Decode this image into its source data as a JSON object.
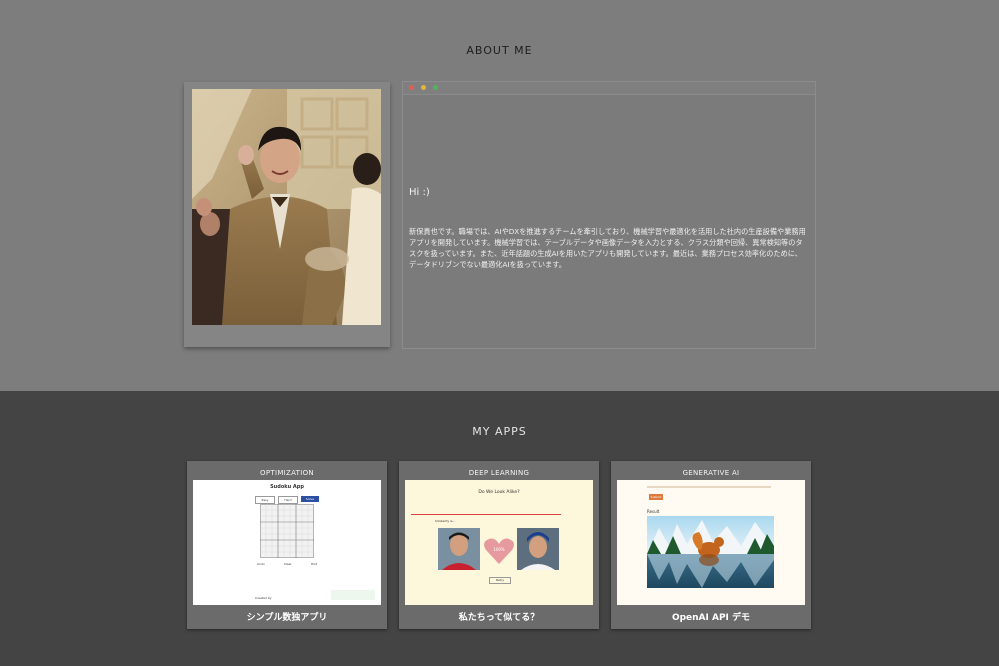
{
  "about": {
    "title": "ABOUT ME",
    "greeting": "Hi :)",
    "bio": "新保貴也です。職場では、AIやDXを推進するチームを牽引しており、機械学習や最適化を活用した社内の生産設備や業務用アプリを開発しています。機械学習では、テーブルデータや画像データを入力とする、クラス分類や回帰、異常検知等のタスクを扱っています。また、近年話題の生成AIを用いたアプリも開発しています。最近は、業務プロセス効率化のために、データドリブンでない最適化AIを扱っています。",
    "window_dots": [
      "#e0604f",
      "#e3b43a",
      "#4fb55a"
    ]
  },
  "apps": {
    "title": "MY APPS",
    "cards": [
      {
        "tag": "OPTIMIZATION",
        "name": "シンプル数独アプリ",
        "preview_title": "Sudoku App",
        "preview_buttons": [
          "Easy",
          "Hard",
          "Solve"
        ],
        "preview_footer": "Created by",
        "preview_ctrl": [
          "Undo",
          "Clear",
          "Hint"
        ]
      },
      {
        "tag": "DEEP LEARNING",
        "name": "私たちって似てる？",
        "preview_title": "Do We Look Alike?",
        "preview_score": "100%",
        "preview_btn": "Retry",
        "preview_label": "Similarity is..."
      },
      {
        "tag": "GENERATIVE AI",
        "name": "OpenAI API デモ",
        "preview_btn": "Submit",
        "preview_result": "Result"
      }
    ]
  }
}
